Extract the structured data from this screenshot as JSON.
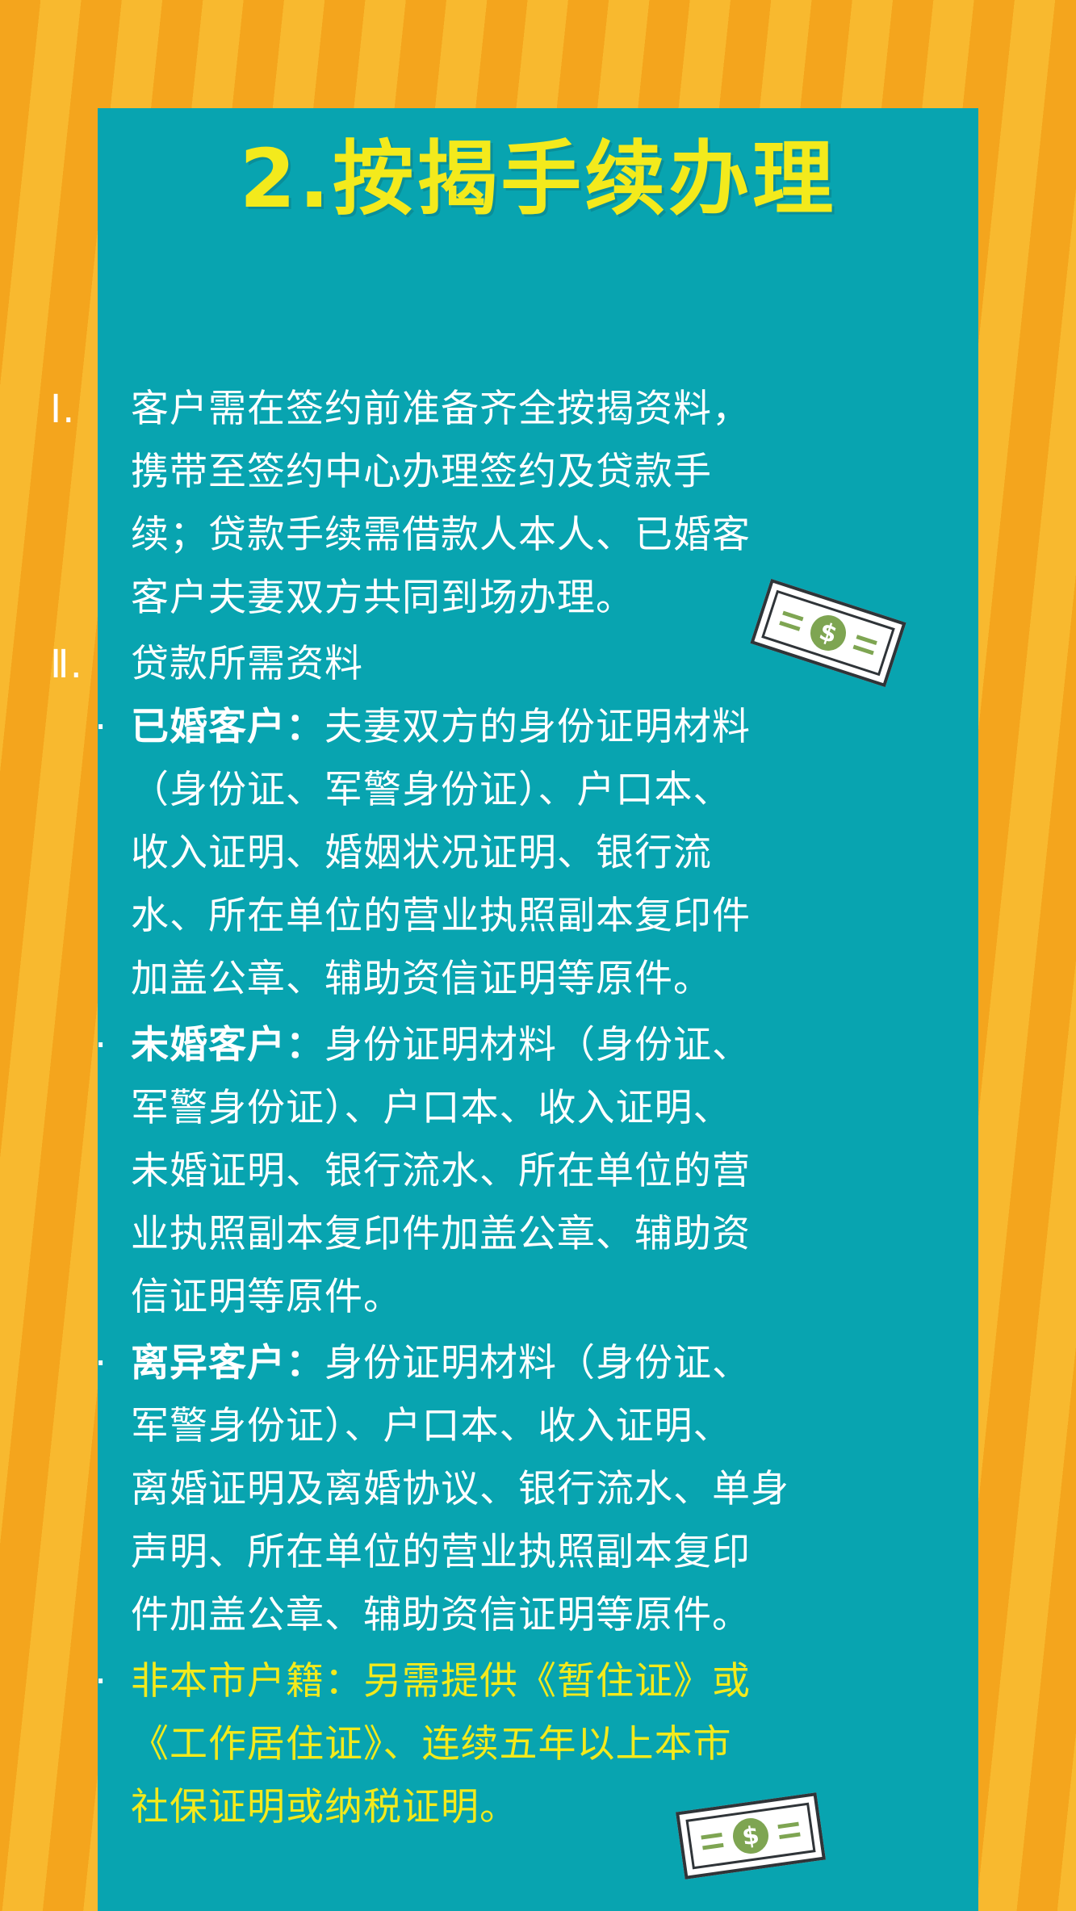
{
  "title": "2.按揭手续办理",
  "section1": {
    "marker": "Ⅰ.",
    "lines": [
      "客户需在签约前准备齐全按揭资料，",
      "携带至签约中心办理签约及贷款手",
      "续；贷款手续需借款人本人、已婚客",
      "客户夫妻双方共同到场办理。"
    ]
  },
  "section2": {
    "marker": "Ⅱ.",
    "heading": "贷款所需资料",
    "bullet": "·",
    "married": {
      "label": "已婚客户：",
      "lines": [
        "夫妻双方的身份证明材料",
        "（身份证、军警身份证）、户口本、",
        "收入证明、婚姻状况证明、银行流",
        "水、所在单位的营业执照副本复印件",
        "加盖公章、辅助资信证明等原件。"
      ]
    },
    "unmarried": {
      "label": "未婚客户：",
      "lines": [
        "身份证明材料（身份证、",
        "军警身份证）、户口本、收入证明、",
        "未婚证明、银行流水、所在单位的营",
        "业执照副本复印件加盖公章、辅助资",
        "信证明等原件。"
      ]
    },
    "divorced": {
      "label": "离异客户：",
      "lines": [
        "身份证明材料（身份证、",
        "军警身份证）、户口本、收入证明、",
        "离婚证明及离婚协议、银行流水、单身",
        "声明、所在单位的营业执照副本复印",
        "件加盖公章、辅助资信证明等原件。"
      ]
    },
    "nonlocal": {
      "label": "非本市户籍：",
      "lines": [
        "另需提供《暂住证》或",
        "《工作居住证》、连续五年以上本市",
        "社保证明或纳税证明。"
      ]
    }
  },
  "bill_symbol": "$",
  "colors": {
    "background_stripe_dark": "#f4a51d",
    "background_stripe_light": "#f8b92f",
    "panel": "#08a4b0",
    "title": "#f3ea1c",
    "text": "#ffffff",
    "highlight": "#f3ea1c",
    "bill_accent": "#7ea552"
  },
  "icons": [
    "money-bill-icon",
    "money-bill-icon"
  ]
}
